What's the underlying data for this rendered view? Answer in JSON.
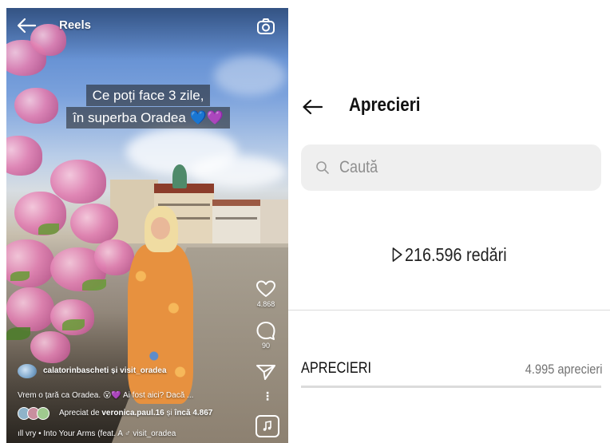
{
  "reels": {
    "header_title": "Reels",
    "caption_line1": "Ce poți face 3 zile,",
    "caption_line2": "în superba Oradea 💙💜",
    "likes_count": "4.868",
    "comments_count": "90",
    "author": "calatorinbascheti și visit_oradea",
    "description": "Vrem o țară ca Oradea. 😮💜 Ai fost aici? Dacă ...",
    "liked_by_prefix": "Apreciat de",
    "liked_by_user": "veronica.paul.16",
    "liked_by_connector": "și",
    "liked_by_others": "încă 4.867",
    "music": "ıll vry • Into Your Arms (feat. A  ♂ visit_oradea"
  },
  "likes_screen": {
    "title": "Aprecieri",
    "search_placeholder": "Caută",
    "views": "216.596 redări",
    "section_label": "APRECIERI",
    "likes_total": "4.995 aprecieri"
  },
  "icons": [
    "back-arrow-icon",
    "camera-icon",
    "heart-icon",
    "comment-icon",
    "send-icon",
    "more-icon",
    "music-icon",
    "search-icon",
    "play-icon"
  ],
  "colors": {
    "panel_bg": "#ffffff",
    "search_bg": "#efefef",
    "muted_text": "#737373",
    "divider": "#dbdbdb"
  }
}
